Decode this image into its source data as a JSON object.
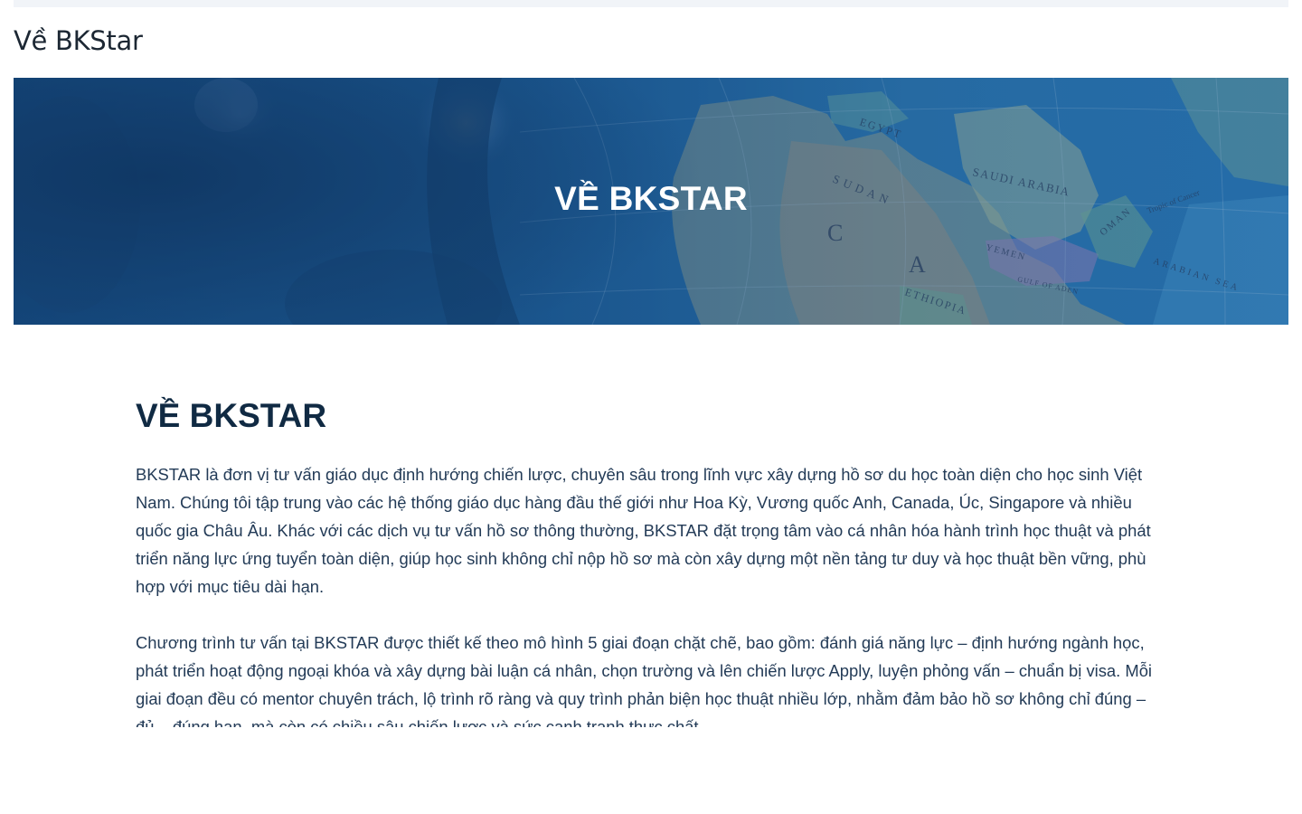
{
  "page": {
    "title": "Về BKStar"
  },
  "hero": {
    "title": "VỀ BKSTAR",
    "map_labels": {
      "egypt": "EGYPT",
      "sudan": "SUDAN",
      "saudi_arabia": "SAUDI ARABIA",
      "ethiopia": "ETHIOPIA",
      "oman": "OMAN",
      "arabian_sea": "ARABIAN SEA",
      "gulf_of_aden": "GULF OF ADEN",
      "tropic_of_cancer": "Tropic of Cancer",
      "yemen": "YEMEN",
      "africa_c": "C",
      "africa_a": "A"
    }
  },
  "content": {
    "heading": "VỀ BKSTAR",
    "paragraphs": [
      "BKSTAR là đơn vị tư vấn giáo dục định hướng chiến lược, chuyên sâu trong lĩnh vực xây dựng hồ sơ du học toàn diện cho học sinh Việt Nam. Chúng tôi tập trung vào các hệ thống giáo dục hàng đầu thế giới như Hoa Kỳ, Vương quốc Anh, Canada, Úc, Singapore và nhiều quốc gia Châu Âu. Khác với các dịch vụ tư vấn hồ sơ thông thường, BKSTAR đặt trọng tâm vào cá nhân hóa hành trình học thuật và phát triển năng lực ứng tuyển toàn diện, giúp học sinh không chỉ nộp hồ sơ mà còn xây dựng một nền tảng tư duy và học thuật bền vững, phù hợp với mục tiêu dài hạn.",
      "Chương trình tư vấn tại BKSTAR được thiết kế theo mô hình 5 giai đoạn chặt chẽ, bao gồm: đánh giá năng lực – định hướng ngành học, phát triển hoạt động ngoại khóa và xây dựng bài luận cá nhân, chọn trường và lên chiến lược Apply, luyện phỏng vấn – chuẩn bị visa. Mỗi giai đoạn đều có mentor chuyên trách, lộ trình rõ ràng và quy trình phản biện học thuật nhiều lớp, nhằm đảm bảo hồ sơ không chỉ đúng – đủ – đúng hạn, mà còn có chiều sâu chiến lược và sức cạnh tranh thực chất."
    ]
  },
  "colors": {
    "hero_overlay": "#1a5287",
    "heading": "#102a43",
    "body_text": "#233b57"
  }
}
